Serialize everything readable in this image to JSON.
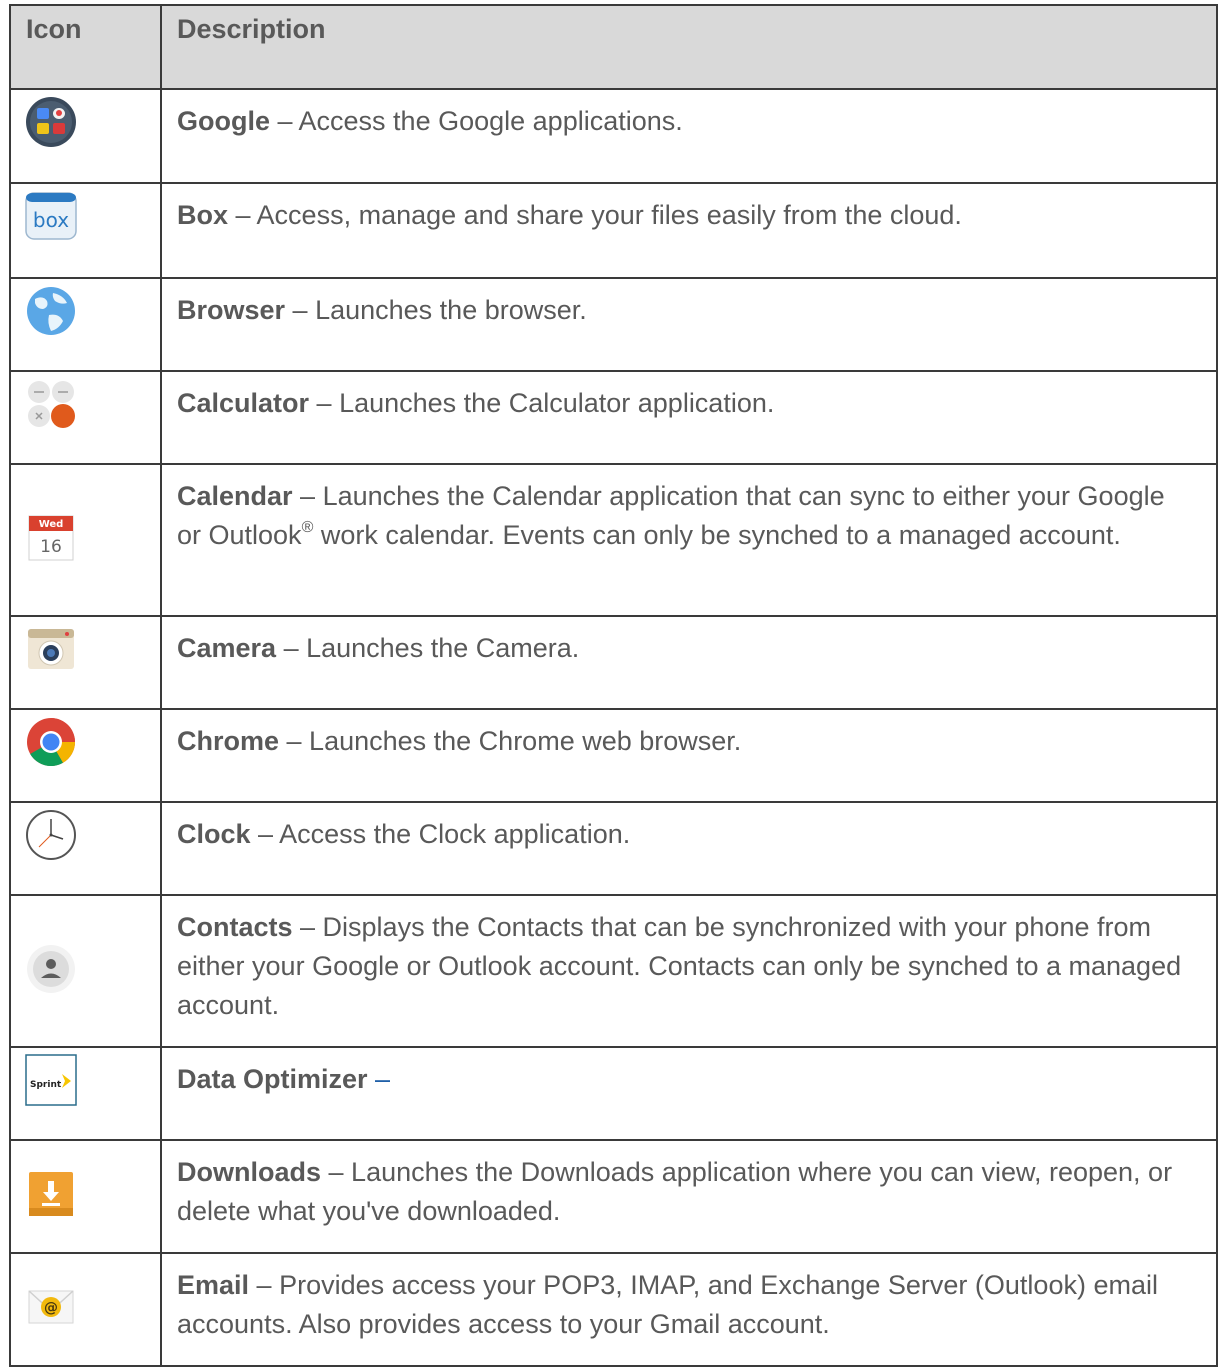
{
  "header": {
    "icon": "Icon",
    "description": "Description"
  },
  "rows": [
    {
      "name": "Google",
      "sep": " – ",
      "text": "Access the Google applications.",
      "icon": "google-folder-icon"
    },
    {
      "name": "Box",
      "sep": " – ",
      "text": "Access, manage and share your files easily from the cloud.",
      "icon": "box-icon",
      "icon_text": "box"
    },
    {
      "name": "Browser",
      "sep": " – ",
      "text": "Launches the browser.",
      "icon": "globe-icon"
    },
    {
      "name": "Calculator",
      "sep": " – ",
      "text": "Launches the Calculator application.",
      "icon": "calculator-icon"
    },
    {
      "name": "Calendar",
      "sep": " – ",
      "text_a": "Launches the Calendar application that can sync to either your Google or Outlook",
      "sup": "®",
      "text_b": " work calendar. Events can only be synched to a managed account.",
      "icon": "calendar-icon",
      "icon_day": "Wed",
      "icon_date": "16"
    },
    {
      "name": "Camera",
      "sep": " – ",
      "text": "Launches the Camera.",
      "icon": "camera-icon"
    },
    {
      "name": "Chrome",
      "sep": " – ",
      "text": "Launches the Chrome web browser.",
      "icon": "chrome-icon"
    },
    {
      "name": "Clock",
      "sep": " – ",
      "text": "Access the Clock application.",
      "icon": "clock-icon"
    },
    {
      "name": "Contacts",
      "sep": " – ",
      "text": "Displays the Contacts that can be synchronized with your phone from either your Google or Outlook account. Contacts can only be synched to a managed account.",
      "icon": "contacts-icon"
    },
    {
      "name": "Data Optimizer",
      "sep": " –",
      "text": "",
      "icon": "sprint-icon",
      "icon_text": "Sprint"
    },
    {
      "name": "Downloads",
      "sep": " – ",
      "text": "Launches the Downloads application where you can view, reopen, or delete what you've downloaded.",
      "icon": "download-icon"
    },
    {
      "name": "Email",
      "sep": " – ",
      "text": "Provides access your POP3, IMAP, and Exchange Server (Outlook) email accounts. Also provides access to your Gmail account.",
      "icon": "email-icon"
    }
  ],
  "colors": {
    "header_bg": "#d9d9d9",
    "text": "#595959",
    "border": "#3a3a3a"
  }
}
